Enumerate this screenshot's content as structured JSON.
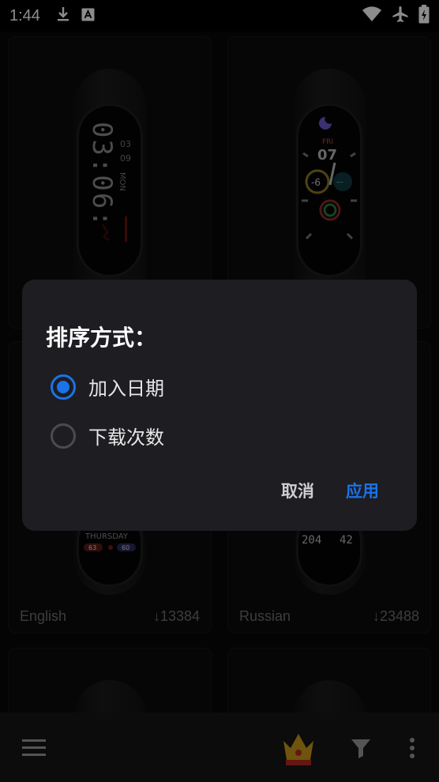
{
  "status_bar": {
    "time": "1:44",
    "icons_left": [
      "download-icon",
      "a-badge-icon"
    ],
    "icons_right": [
      "wifi-icon",
      "airplane-icon",
      "battery-charging-icon"
    ]
  },
  "grid": {
    "cards": [
      {
        "watch_text": "03:06:",
        "date_text": "03",
        "sub_text": "09",
        "day_text": "MON",
        "language": "",
        "downloads": ""
      },
      {
        "watch_text": "07",
        "date_text": "FRI",
        "sub_text": "-6",
        "day_text": "",
        "language": "",
        "downloads": ""
      },
      {
        "watch_text": "",
        "date_text": "THURSDAY",
        "sub_text": "63",
        "day_text": "60",
        "language": "English",
        "downloads": "↓13384"
      },
      {
        "watch_text": "204",
        "date_text": "42",
        "sub_text": "",
        "day_text": "",
        "language": "Russian",
        "downloads": "↓23488"
      }
    ]
  },
  "dialog": {
    "title": "排序方式：",
    "options": [
      {
        "label": "加入日期",
        "checked": true
      },
      {
        "label": "下载次数",
        "checked": false
      }
    ],
    "cancel_label": "取消",
    "apply_label": "应用",
    "accent_color": "#1a73e8"
  },
  "bottom_bar": {
    "icons": [
      "menu-icon",
      "crown-icon",
      "filter-icon",
      "more-vertical-icon"
    ]
  }
}
